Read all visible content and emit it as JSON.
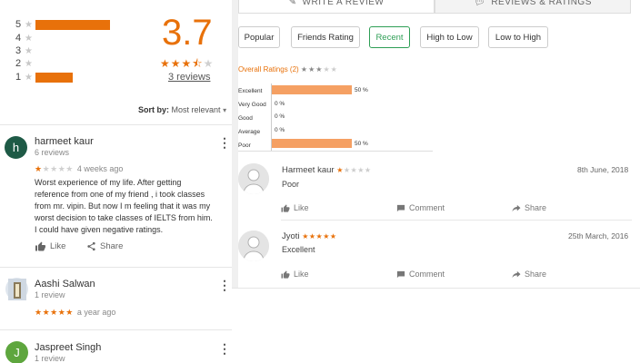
{
  "left": {
    "distribution": [
      {
        "star": "5",
        "fraction": 0.667
      },
      {
        "star": "4",
        "fraction": 0
      },
      {
        "star": "3",
        "fraction": 0
      },
      {
        "star": "2",
        "fraction": 0
      },
      {
        "star": "1",
        "fraction": 0.333
      }
    ],
    "average": "3.7",
    "average_stars": "★★★⯪☆",
    "reviews_link": "3 reviews",
    "sort_by_label": "Sort by:",
    "sort_value": "Most relevant",
    "reviews": [
      {
        "initial": "h",
        "avatar_color": "#1e5a46",
        "name": "harmeet kaur",
        "count": "6 reviews",
        "stars_on": "★",
        "stars_off": "★★★★",
        "time": "4 weeks ago",
        "text": "Worst experience of my life. After getting reference from one of my friend , i took classes from mr. vipin. But now I m feeling that it was my worst decision to take classes of IELTS from him. I could have given negative ratings.",
        "like": "Like",
        "share": "Share"
      },
      {
        "initial": "",
        "name": "Aashi Salwan",
        "count": "1 review",
        "stars_on": "★★★★★",
        "stars_off": "",
        "time": "a year ago"
      },
      {
        "initial": "J",
        "avatar_color": "#5ea63e",
        "name": "Jaspreet Singh",
        "count": "1 review"
      }
    ]
  },
  "right": {
    "tabs": [
      "WRITE A REVIEW",
      "REVIEWS & RATINGS"
    ],
    "filters": [
      "Popular",
      "Friends Rating",
      "Recent",
      "High to Low",
      "Low to High"
    ],
    "active_filter": "Recent",
    "overall_label": "Overall Ratings (2)",
    "overall_stars_on": "★★★",
    "overall_stars_off": "★★",
    "breakdown": [
      {
        "label": "Excellent",
        "percent": 50,
        "value": "50 %"
      },
      {
        "label": "Very Good",
        "percent": 0,
        "value": "0 %"
      },
      {
        "label": "Good",
        "percent": 0,
        "value": "0 %"
      },
      {
        "label": "Average",
        "percent": 0,
        "value": "0 %"
      },
      {
        "label": "Poor",
        "percent": 50,
        "value": "50 %"
      }
    ],
    "reviews": [
      {
        "name": "Harmeet kaur",
        "stars_on": "★",
        "stars_off": "★★★★",
        "date": "8th June, 2018",
        "text": "Poor"
      },
      {
        "name": "Jyoti",
        "stars_on": "★★★★★",
        "stars_off": "",
        "date": "25th March, 2016",
        "text": "Excellent"
      }
    ],
    "actions": {
      "like": "Like",
      "comment": "Comment",
      "share": "Share"
    }
  }
}
